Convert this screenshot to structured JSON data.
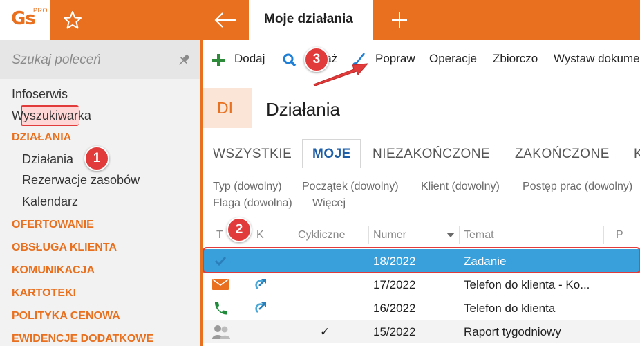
{
  "app": {
    "logo_text": "Gs",
    "logo_badge": "PRO",
    "active_tab": "Moje działania",
    "accent_color": "#e8701f"
  },
  "sidebar": {
    "search_placeholder": "Szukaj poleceń",
    "items": [
      {
        "label": "Infoserwis",
        "kind": "link"
      },
      {
        "label": "Wyszukiwarka",
        "kind": "link"
      },
      {
        "label": "DZIAŁANIA",
        "kind": "section"
      },
      {
        "label": "Działania",
        "kind": "sub",
        "active": true
      },
      {
        "label": "Rezerwacje zasobów",
        "kind": "sub"
      },
      {
        "label": "Kalendarz",
        "kind": "sub"
      },
      {
        "label": "OFERTOWANIE",
        "kind": "section"
      },
      {
        "label": "OBSŁUGA KLIENTA",
        "kind": "section"
      },
      {
        "label": "KOMUNIKACJA",
        "kind": "section"
      },
      {
        "label": "KARTOTEKI",
        "kind": "section"
      },
      {
        "label": "POLITYKA CENOWA",
        "kind": "section"
      },
      {
        "label": "EWIDENCJE DODATKOWE",
        "kind": "section"
      }
    ]
  },
  "toolbar": {
    "add": "Dodaj",
    "show": "Pokaż",
    "edit": "Popraw",
    "operations": "Operacje",
    "bulk": "Zbiorczo",
    "issue_doc": "Wystaw dokument"
  },
  "header": {
    "badge": "DI",
    "title": "Działania"
  },
  "tabs": [
    "WSZYSTKIE",
    "MOJE",
    "NIEZAKOŃCZONE",
    "ZAKOŃCZONE",
    "K"
  ],
  "filters": {
    "type": "Typ (dowolny)",
    "start": "Początek (dowolny)",
    "client": "Klient (dowolny)",
    "progress": "Postęp prac (dowolny)",
    "flag": "Flaga (dowolna)",
    "more": "Więcej"
  },
  "table": {
    "columns": [
      "T",
      "K",
      "Cykliczne",
      "Numer",
      "Temat",
      "P"
    ],
    "rows": [
      {
        "type_icon": "check-icon",
        "k_icon": "",
        "cyclic": "",
        "number": "18/2022",
        "subject": "Zadanie",
        "selected": true
      },
      {
        "type_icon": "envelope-icon",
        "k_icon": "outgoing-arrow-icon",
        "cyclic": "",
        "number": "17/2022",
        "subject": "Telefon do klienta - Ko..."
      },
      {
        "type_icon": "phone-icon",
        "k_icon": "outgoing-arrow-icon",
        "cyclic": "",
        "number": "16/2022",
        "subject": "Telefon do klienta"
      },
      {
        "type_icon": "people-icon",
        "k_icon": "",
        "cyclic": "✓",
        "number": "15/2022",
        "subject": "Raport tygodniowy"
      }
    ]
  },
  "markers": {
    "m1": "1",
    "m2": "2",
    "m3": "3",
    "color": "#e23b3b"
  }
}
